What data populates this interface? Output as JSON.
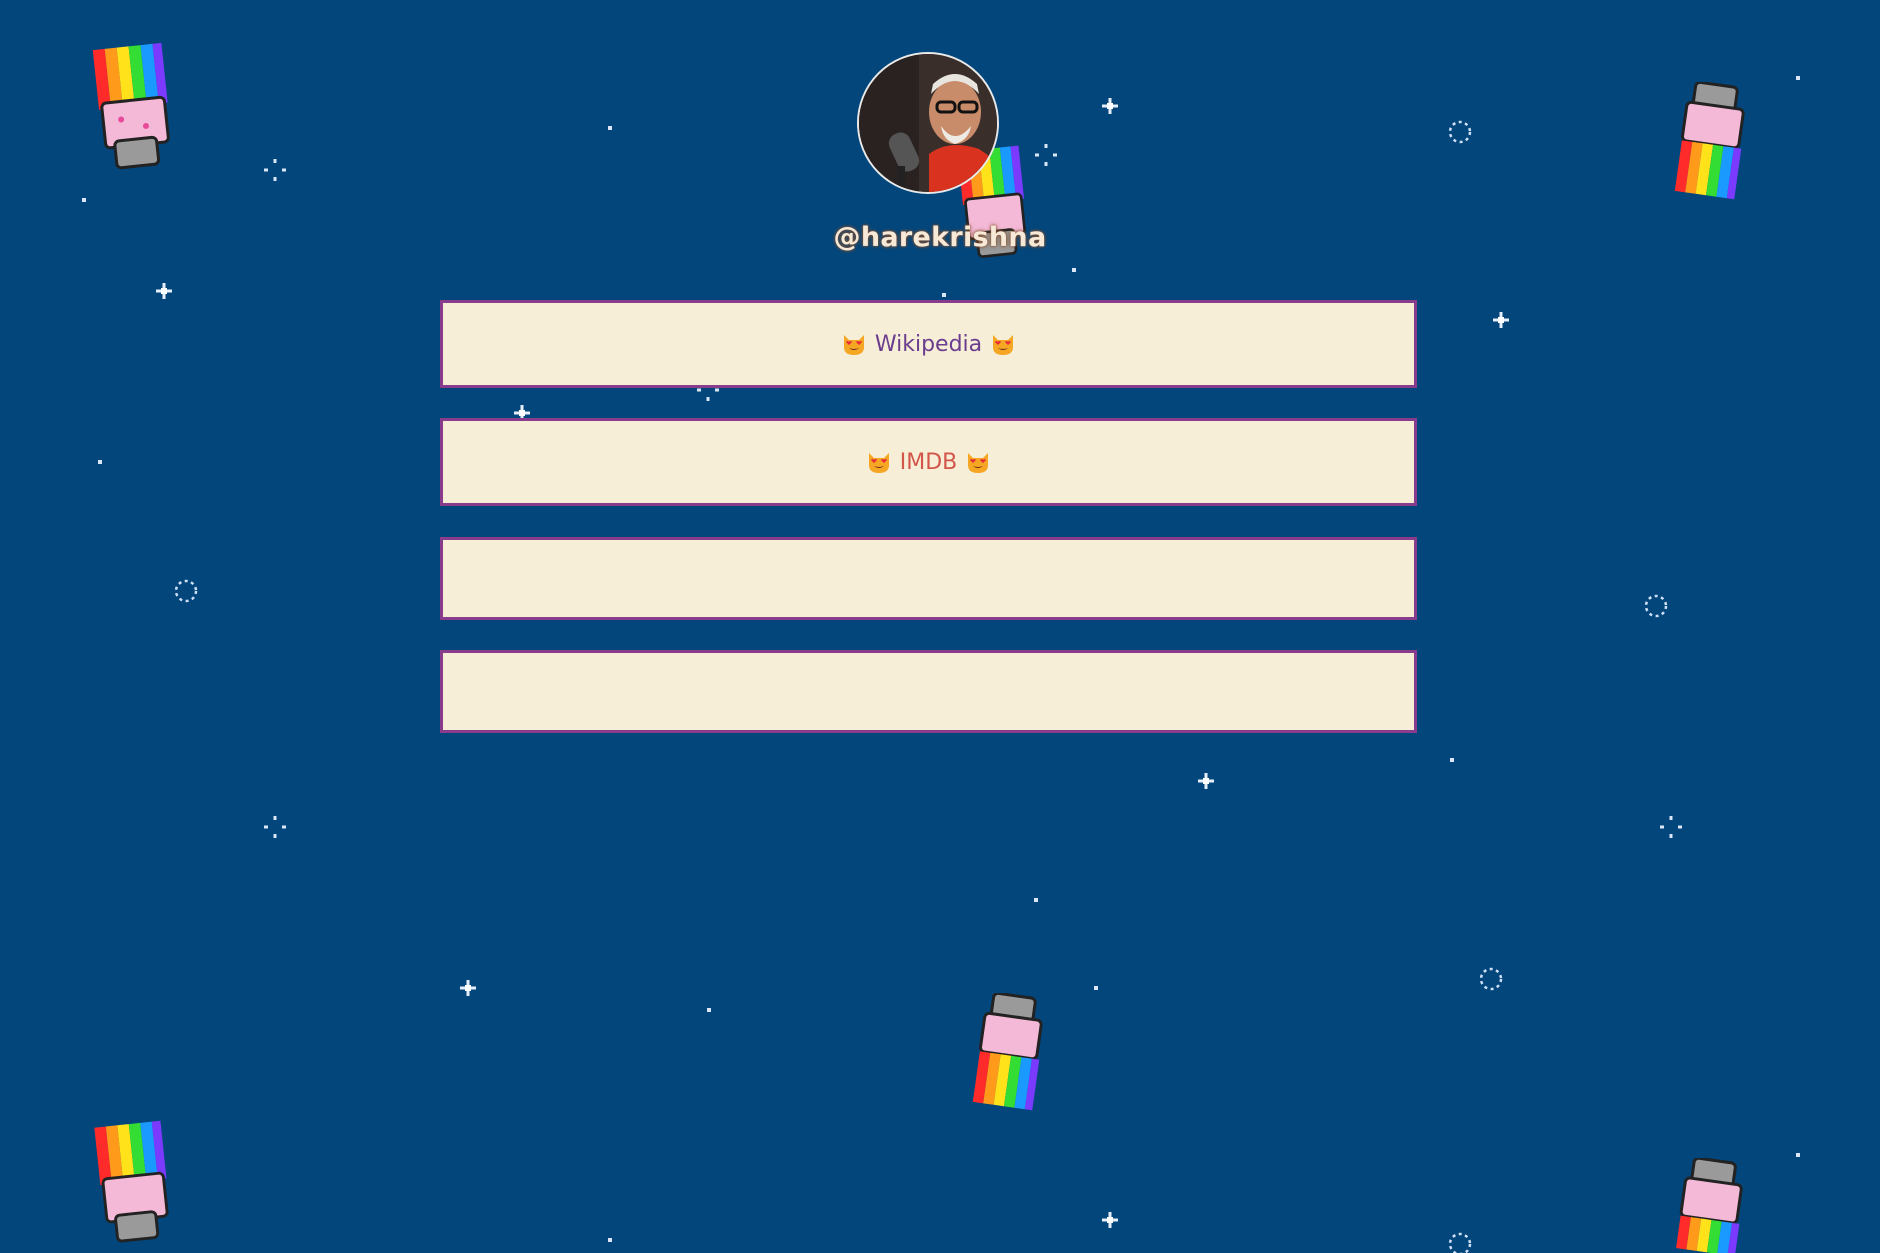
{
  "profile": {
    "handle": "@harekrishna",
    "avatar_alt": "profile-photo"
  },
  "links": [
    {
      "label": "Wikipedia",
      "prefix_icon": "heart-eyes-cat-emoji",
      "suffix_icon": "heart-eyes-cat-emoji",
      "label_color": "#6b3d8e"
    },
    {
      "label": "IMDB",
      "prefix_icon": "heart-eyes-cat-emoji",
      "suffix_icon": "heart-eyes-cat-emoji",
      "label_color": "#d4554a"
    },
    {
      "label": ""
    },
    {
      "label": ""
    }
  ],
  "theme": {
    "background": "#02467c",
    "button_fill": "#f6eed6",
    "button_border": "#8a3c8c",
    "handle_color": "#f7e9d7"
  },
  "decorations": {
    "background_sprite": "nyan-cat-icon",
    "stars": "sparkle-star-icon"
  }
}
